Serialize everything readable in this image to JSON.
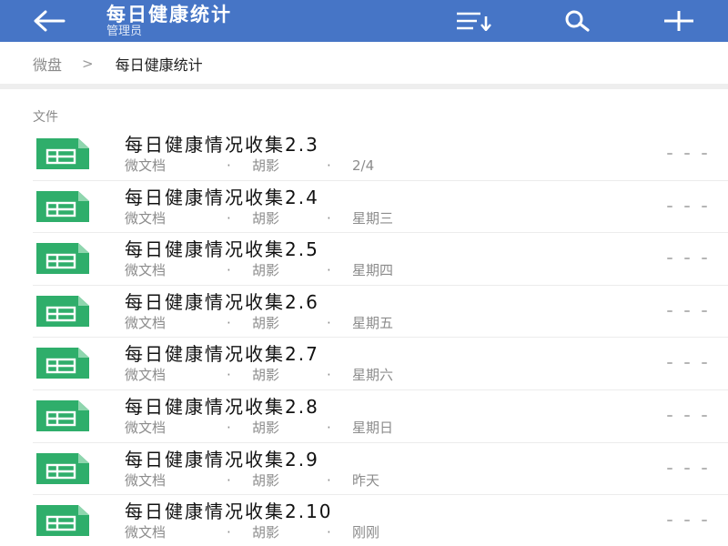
{
  "header": {
    "title": "每日健康统计",
    "subtitle": "管理员"
  },
  "breadcrumb": {
    "root": "微盘",
    "separator": ">",
    "current": "每日健康统计"
  },
  "section": {
    "label": "文件"
  },
  "files": [
    {
      "name": "每日健康情况收集2.3",
      "type": "微文档",
      "author": "胡影",
      "date": "2/4"
    },
    {
      "name": "每日健康情况收集2.4",
      "type": "微文档",
      "author": "胡影",
      "date": "星期三"
    },
    {
      "name": "每日健康情况收集2.5",
      "type": "微文档",
      "author": "胡影",
      "date": "星期四"
    },
    {
      "name": "每日健康情况收集2.6",
      "type": "微文档",
      "author": "胡影",
      "date": "星期五"
    },
    {
      "name": "每日健康情况收集2.7",
      "type": "微文档",
      "author": "胡影",
      "date": "星期六"
    },
    {
      "name": "每日健康情况收集2.8",
      "type": "微文档",
      "author": "胡影",
      "date": "星期日"
    },
    {
      "name": "每日健康情况收集2.9",
      "type": "微文档",
      "author": "胡影",
      "date": "昨天"
    },
    {
      "name": "每日健康情况收集2.10",
      "type": "微文档",
      "author": "胡影",
      "date": "刚刚"
    }
  ],
  "meta_separator": "·",
  "icons": {
    "back": "back-arrow-icon",
    "sort": "sort-icon",
    "search": "search-icon",
    "add": "plus-icon",
    "file": "spreadsheet-icon",
    "more": "more-icon"
  },
  "colors": {
    "header": "#4675c6",
    "spreadsheet": "#2fae6b",
    "spreadsheet_fold": "#8fd6ae"
  }
}
